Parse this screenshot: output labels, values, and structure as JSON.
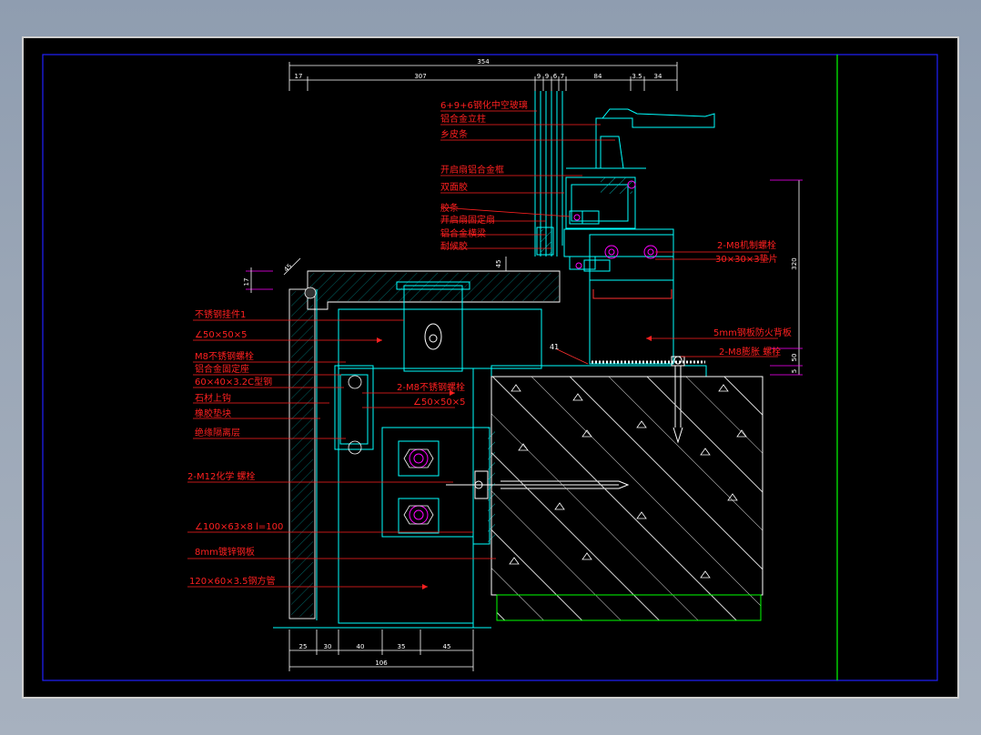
{
  "dimensions_top": [
    "354",
    "17",
    "307",
    "9",
    "9",
    "6",
    "7",
    "84",
    "3.5",
    "34"
  ],
  "dimensions_bottom": [
    "106",
    "25",
    "30",
    "40",
    "35",
    "45"
  ],
  "dimensions_right": [
    "320",
    "50",
    "5"
  ],
  "dimension_left_small": "17",
  "dimension_angle": "45",
  "dimension_slope": "41",
  "dimension_gap": "45",
  "labels_upper": [
    "6+9+6钢化中空玻璃",
    "铝合金立柱",
    "乡皮条",
    "开启扇铝合金框",
    "双面胶",
    "胶条",
    "开启扇固定扇",
    "铝合金横梁",
    "耐候胶"
  ],
  "labels_right": [
    "2-M8机制螺栓",
    "30×30×3垫片",
    "5mm钢板防火背板",
    "2-M8膨胀 螺栓"
  ],
  "labels_left": [
    "不锈钢挂件1",
    "∠50×50×5",
    "M8不锈钢螺栓",
    "铝合金固定座",
    "60×40×3.2C型钢",
    "石材上钩",
    "橡胶垫块",
    "绝缘隔离层"
  ],
  "label_center": [
    "2-M8不锈钢螺栓",
    "∠50×50×5"
  ],
  "labels_lower_left": [
    "2-M12化学 螺栓",
    "∠100×63×8  l=100",
    "8mm镀锌钢板",
    "120×60×3.5钢方管"
  ],
  "colors": {
    "line": "#00ffff",
    "label": "#ff2020",
    "dim": "#ffffff",
    "leader": "#ff00ff",
    "frame": "#2020ff",
    "green": "#00ff00",
    "concrete": "#8fd8d8"
  }
}
